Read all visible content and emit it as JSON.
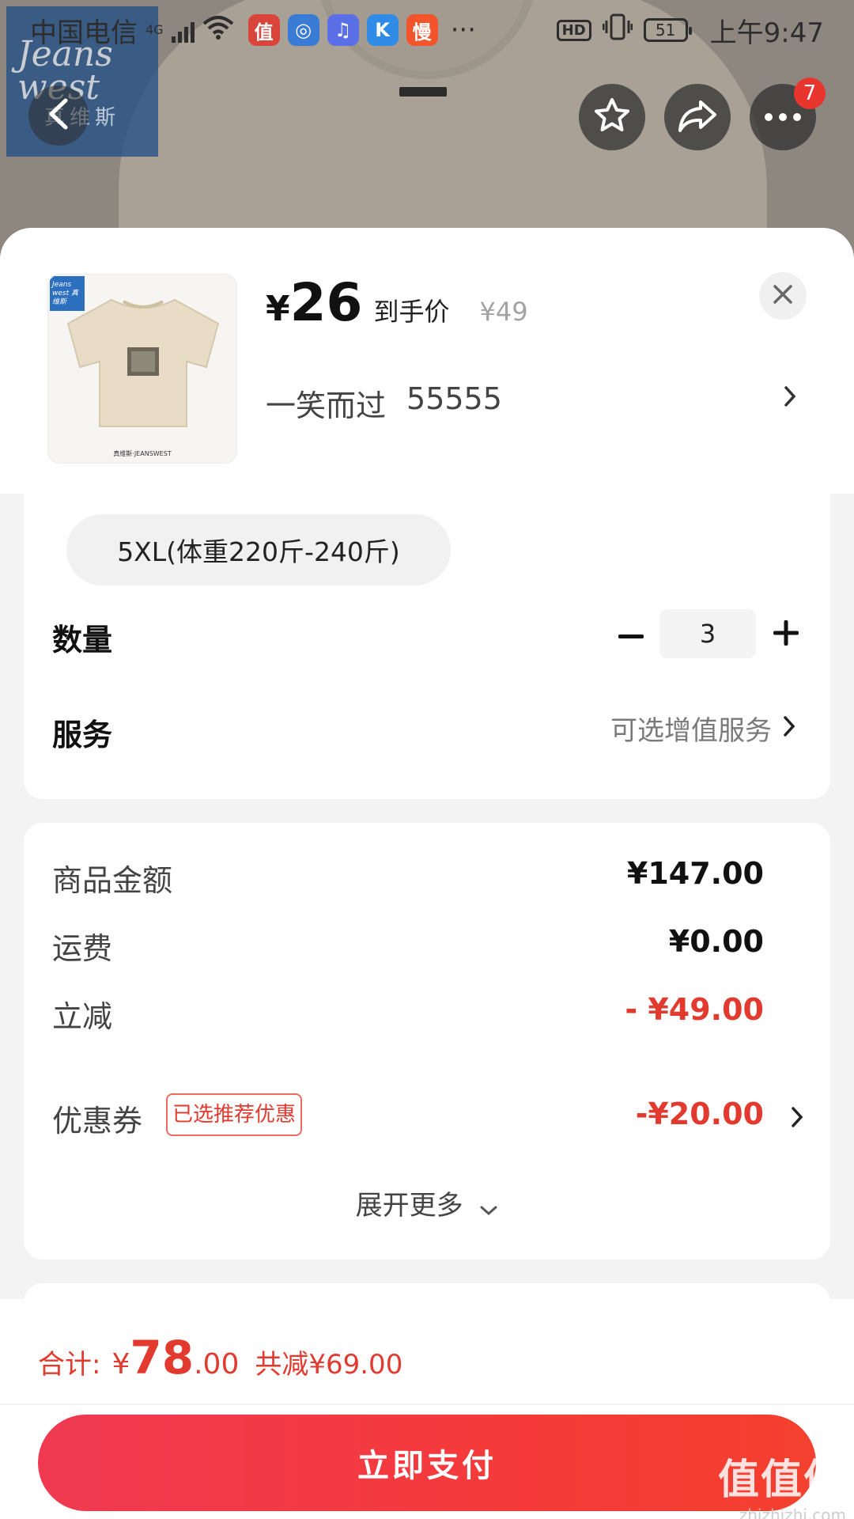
{
  "status_bar": {
    "carrier": "中国电信",
    "network": "4G",
    "app_icons": [
      {
        "name": "zhi-app-icon",
        "glyph": "值",
        "color": "#d9453b"
      },
      {
        "name": "browser-app-icon",
        "glyph": "◎",
        "color": "#3a7bd5"
      },
      {
        "name": "music-app-icon",
        "glyph": "♫",
        "color": "#5b6fe6"
      },
      {
        "name": "k-app-icon",
        "glyph": "K",
        "color": "#2f8be6"
      },
      {
        "name": "man-app-icon",
        "glyph": "慢",
        "color": "#f2552c"
      }
    ],
    "more_dots": "···",
    "hd": "HD",
    "battery": "51",
    "time": "上午9:47"
  },
  "backdrop": {
    "brand_logo_line1": "Jeans",
    "brand_logo_line2": "west",
    "brand_logo_cn": "真维斯"
  },
  "nav": {
    "more_badge": "7"
  },
  "product": {
    "price_symbol": "¥",
    "price": "26",
    "price_tag": "到手价",
    "original_price": "¥49",
    "variant_name": "一笑而过",
    "variant_code": "55555",
    "thumb_logo": "Jeans west 真维斯",
    "thumb_footer": "真维斯·JEANSWEST"
  },
  "options": {
    "size": "5XL(体重220斤-240斤)",
    "quantity_label": "数量",
    "quantity": "3",
    "service_label": "服务",
    "service_value": "可选增值服务"
  },
  "fees": {
    "goods_label": "商品金额",
    "goods_value": "¥147.00",
    "shipping_label": "运费",
    "shipping_value": "¥0.00",
    "instant_label": "立减",
    "instant_value": "- ¥49.00",
    "coupon_label": "优惠券",
    "coupon_tag": "已选推荐优惠",
    "coupon_value": "-¥20.00",
    "expand_label": "展开更多"
  },
  "footer": {
    "total_label": "合计:",
    "total_symbol": "¥",
    "total_int": "78",
    "total_dec": ".00",
    "total_saved": "共减¥69.00",
    "pay_label": "立即支付"
  },
  "watermark": {
    "line1": "值值值",
    "line2": "zhizhizhi.com"
  },
  "colors": {
    "accent_red": "#e23a2e",
    "pay_gradient_start": "#f03a52",
    "pay_gradient_end": "#f4402e"
  }
}
